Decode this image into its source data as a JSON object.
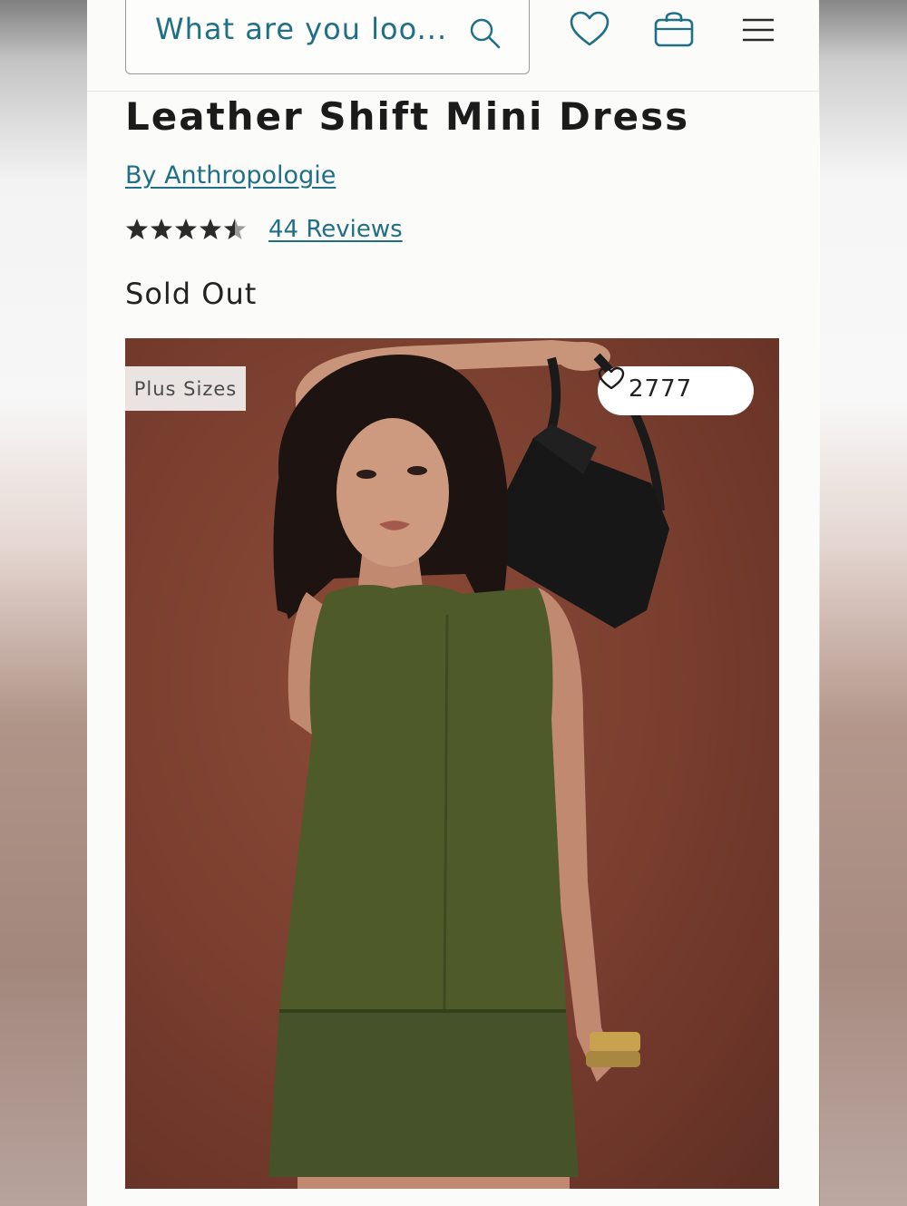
{
  "header": {
    "search_placeholder": "What are you loo...",
    "icons": [
      "search-icon",
      "heart-icon",
      "bag-icon",
      "menu-icon"
    ]
  },
  "product": {
    "title": "Leather Shift Mini Dress",
    "brand_link": "By Anthropologie",
    "rating": 4.5,
    "rating_max": 5,
    "reviews_link": "44 Reviews",
    "availability": "Sold Out"
  },
  "image": {
    "tag": "Plus Sizes",
    "favorite_count": "2777"
  },
  "colors": {
    "link": "#1f6f86",
    "text": "#1b1b1b",
    "background": "#fbfbf9",
    "photo_backdrop": "#7c4030",
    "dress": "#4e5a2a"
  }
}
